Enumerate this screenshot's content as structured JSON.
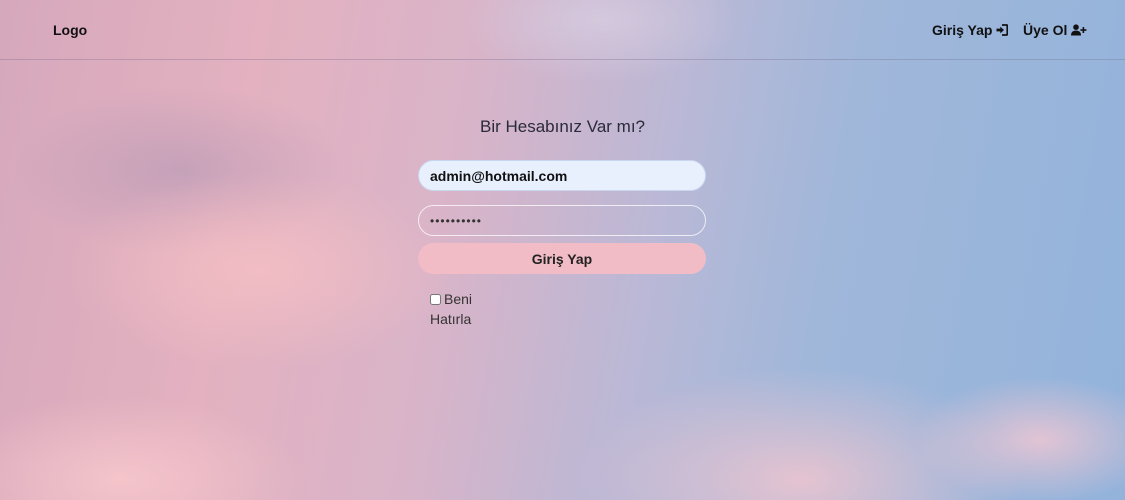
{
  "header": {
    "logo": "Logo",
    "login_label": "Giriş Yap",
    "login_icon": "sign-in-icon",
    "register_label": "Üye Ol",
    "register_icon": "user-plus-icon"
  },
  "form": {
    "title": "Bir Hesabınız Var mı?",
    "email_value": "admin@hotmail.com",
    "password_value": "••••••••••",
    "submit_label": "Giriş Yap",
    "remember_label": "Beni Hatırla",
    "remember_checked": false
  }
}
